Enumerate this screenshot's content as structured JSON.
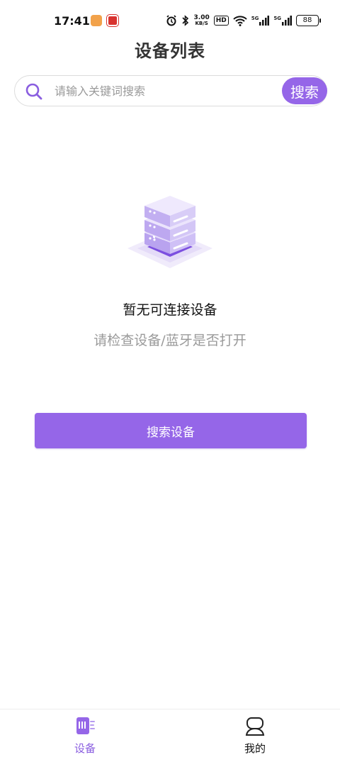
{
  "status_bar": {
    "time": "17:41",
    "net_speed_value": "3.00",
    "net_speed_unit": "KB/S",
    "hd_label": "HD",
    "signal_1": "5G",
    "signal_2": "5G",
    "battery": "88"
  },
  "header": {
    "title": "设备列表"
  },
  "search": {
    "placeholder": "请输入关键词搜索",
    "value": "",
    "button_label": "搜索"
  },
  "empty_state": {
    "icon": "server-icon",
    "title": "暂无可连接设备",
    "subtitle": "请检查设备/蓝牙是否打开",
    "action_label": "搜索设备"
  },
  "bottom_nav": {
    "items": [
      {
        "label": "设备",
        "icon": "device-icon",
        "active": true
      },
      {
        "label": "我的",
        "icon": "user-icon",
        "active": false
      }
    ]
  },
  "colors": {
    "accent": "#9566e8",
    "accent_text": "#8a5ee0",
    "muted": "#9a9a9a"
  }
}
